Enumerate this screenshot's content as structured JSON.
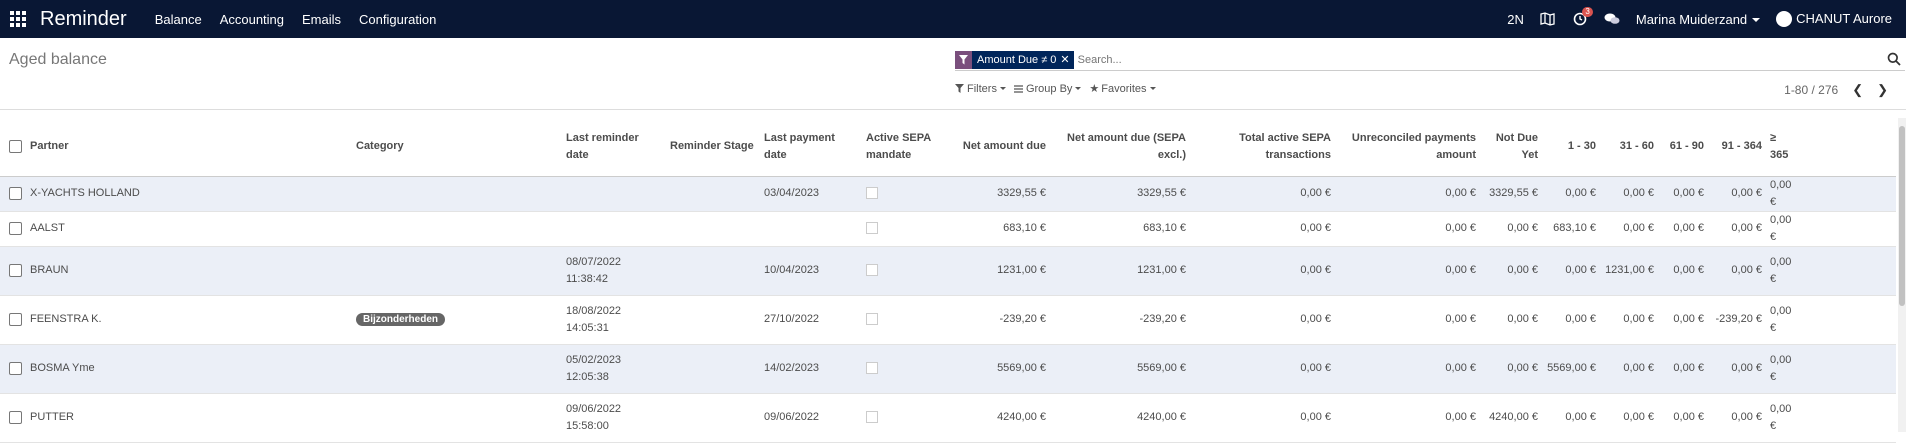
{
  "navbar": {
    "brand": "Reminder",
    "menu": [
      "Balance",
      "Accounting",
      "Emails",
      "Configuration"
    ],
    "company": "2N",
    "activity_badge": "3",
    "user": "Marina Muiderzand",
    "company_user": "CHANUT Aurore"
  },
  "control": {
    "title": "Aged balance",
    "facet": "Amount Due ≠ 0",
    "search_placeholder": "Search...",
    "filters": "Filters",
    "group_by": "Group By",
    "favorites": "Favorites",
    "pager": "1-80 / 276"
  },
  "columns": {
    "partner": "Partner",
    "category": "Category",
    "last_reminder_date": "Last reminder date",
    "reminder_stage": "Reminder Stage",
    "last_payment_date": "Last payment date",
    "active_sepa_mandate": "Active SEPA mandate",
    "net_amount_due": "Net amount due",
    "net_amount_due_sepa": "Net amount due (SEPA excl.)",
    "total_active_sepa": "Total active SEPA transactions",
    "unreconciled": "Unreconciled payments amount",
    "not_due_yet": "Not Due Yet",
    "d1_30": "1 - 30",
    "d31_60": "31 - 60",
    "d61_90": "61 - 90",
    "d91_364": "91 - 364",
    "d365": "≥ 365"
  },
  "rows": [
    {
      "partner": "X-YACHTS HOLLAND",
      "category": "",
      "reminder_date": "",
      "reminder_time": "",
      "stage": "",
      "payment_date": "03/04/2023",
      "net": "3329,55 €",
      "net_sepa": "3329,55 €",
      "sepa": "0,00 €",
      "unrec": "0,00 €",
      "not_due": "3329,55 €",
      "d1": "0,00 €",
      "d2": "0,00 €",
      "d3": "0,00 €",
      "d4": "0,00 €",
      "d5": "0,00 €"
    },
    {
      "partner": "AALST",
      "category": "",
      "reminder_date": "",
      "reminder_time": "",
      "stage": "",
      "payment_date": "",
      "net": "683,10 €",
      "net_sepa": "683,10 €",
      "sepa": "0,00 €",
      "unrec": "0,00 €",
      "not_due": "0,00 €",
      "d1": "683,10 €",
      "d2": "0,00 €",
      "d3": "0,00 €",
      "d4": "0,00 €",
      "d5": "0,00 €"
    },
    {
      "partner": "BRAUN",
      "category": "",
      "reminder_date": "08/07/2022",
      "reminder_time": "11:38:42",
      "stage": "",
      "payment_date": "10/04/2023",
      "net": "1231,00 €",
      "net_sepa": "1231,00 €",
      "sepa": "0,00 €",
      "unrec": "0,00 €",
      "not_due": "0,00 €",
      "d1": "0,00 €",
      "d2": "1231,00 €",
      "d3": "0,00 €",
      "d4": "0,00 €",
      "d5": "0,00 €"
    },
    {
      "partner": "FEENSTRA K.",
      "category": "Bijzonderheden",
      "reminder_date": "18/08/2022",
      "reminder_time": "14:05:31",
      "stage": "",
      "payment_date": "27/10/2022",
      "net": "-239,20 €",
      "net_sepa": "-239,20 €",
      "sepa": "0,00 €",
      "unrec": "0,00 €",
      "not_due": "0,00 €",
      "d1": "0,00 €",
      "d2": "0,00 €",
      "d3": "0,00 €",
      "d4": "-239,20 €",
      "d5": "0,00 €"
    },
    {
      "partner": "BOSMA Yme",
      "category": "",
      "reminder_date": "05/02/2023",
      "reminder_time": "12:05:38",
      "stage": "",
      "payment_date": "14/02/2023",
      "net": "5569,00 €",
      "net_sepa": "5569,00 €",
      "sepa": "0,00 €",
      "unrec": "0,00 €",
      "not_due": "0,00 €",
      "d1": "5569,00 €",
      "d2": "0,00 €",
      "d3": "0,00 €",
      "d4": "0,00 €",
      "d5": "0,00 €"
    },
    {
      "partner": "PUTTER",
      "category": "",
      "reminder_date": "09/06/2022",
      "reminder_time": "15:58:00",
      "stage": "",
      "payment_date": "09/06/2022",
      "net": "4240,00 €",
      "net_sepa": "4240,00 €",
      "sepa": "0,00 €",
      "unrec": "0,00 €",
      "not_due": "4240,00 €",
      "d1": "0,00 €",
      "d2": "0,00 €",
      "d3": "0,00 €",
      "d4": "0,00 €",
      "d5": "0,00 €"
    }
  ]
}
